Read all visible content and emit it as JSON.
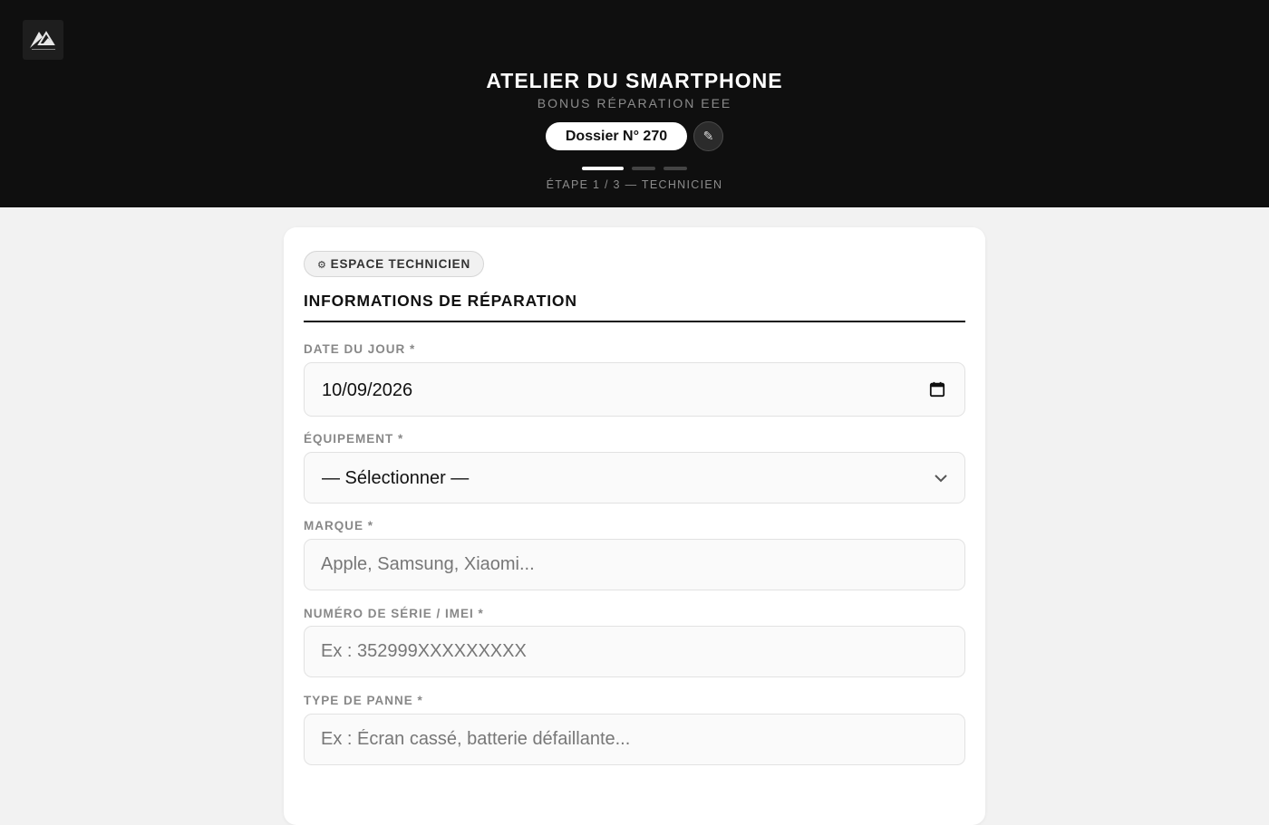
{
  "header": {
    "logo_icon": "mountain-logo-icon",
    "title": "ATELIER DU SMARTPHONE",
    "subtitle": "BONUS RÉPARATION EEE",
    "dossier": "Dossier N° 270",
    "edit_icon": "pencil-icon",
    "step_label": "ÉTAPE 1 / 3 — TECHNICIEN",
    "steps_total": 3,
    "step_current": 1
  },
  "card": {
    "badge_icon": "gear-icon",
    "badge_label": "ESPACE TECHNICIEN",
    "section_title": "INFORMATIONS DE RÉPARATION",
    "fields": {
      "date": {
        "label": "DATE DU JOUR *",
        "value": "10/09/2026",
        "icon": "calendar-icon"
      },
      "equipement": {
        "label": "ÉQUIPEMENT *",
        "value": "— Sélectionner —",
        "icon": "chevron-down-icon"
      },
      "marque": {
        "label": "MARQUE *",
        "placeholder": "Apple, Samsung, Xiaomi..."
      },
      "serie": {
        "label": "NUMÉRO DE SÉRIE / IMEI *",
        "placeholder": "Ex : 352999XXXXXXXXX"
      },
      "panne": {
        "label": "TYPE DE PANNE *",
        "placeholder": "Ex : Écran cassé, batterie défaillante..."
      }
    }
  },
  "colors": {
    "header_bg": "#0f0f0f",
    "page_bg": "#f2f2f2",
    "accent": "#111111"
  }
}
